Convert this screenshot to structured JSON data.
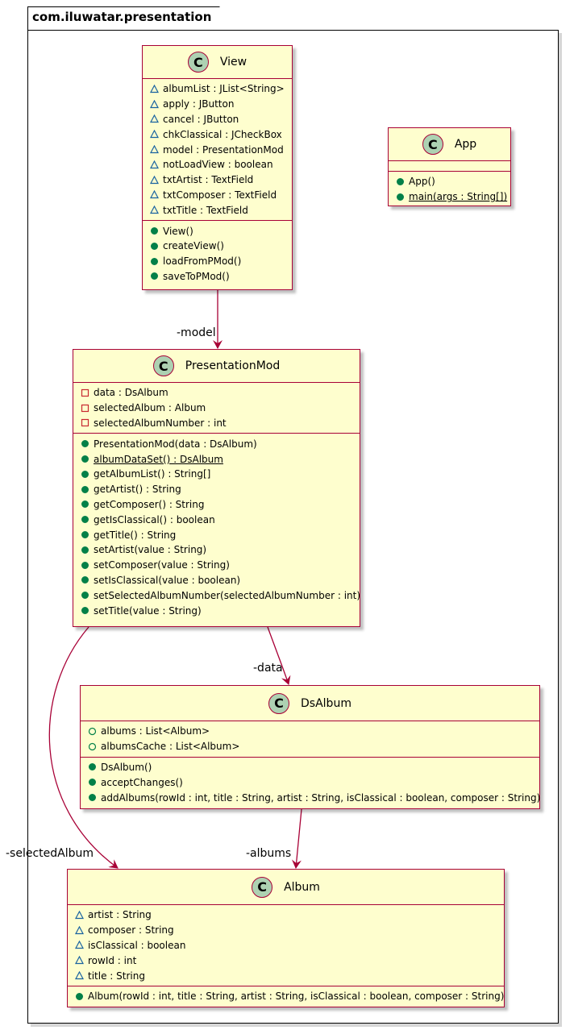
{
  "package": {
    "name": "com.iluwatar.presentation"
  },
  "classes": {
    "view": {
      "badge": "C",
      "name": "View",
      "fields": [
        {
          "vis": "package",
          "text": "albumList : JList<String>"
        },
        {
          "vis": "package",
          "text": "apply : JButton"
        },
        {
          "vis": "package",
          "text": "cancel : JButton"
        },
        {
          "vis": "package",
          "text": "chkClassical : JCheckBox"
        },
        {
          "vis": "package",
          "text": "model : PresentationMod"
        },
        {
          "vis": "package",
          "text": "notLoadView : boolean"
        },
        {
          "vis": "package",
          "text": "txtArtist : TextField"
        },
        {
          "vis": "package",
          "text": "txtComposer : TextField"
        },
        {
          "vis": "package",
          "text": "txtTitle : TextField"
        }
      ],
      "methods": [
        {
          "vis": "public",
          "text": "View()"
        },
        {
          "vis": "public",
          "text": "createView()"
        },
        {
          "vis": "public",
          "text": "loadFromPMod()"
        },
        {
          "vis": "public",
          "text": "saveToPMod()"
        }
      ]
    },
    "app": {
      "badge": "C",
      "name": "App",
      "fields": [],
      "methods": [
        {
          "vis": "public",
          "text": "App()"
        },
        {
          "vis": "public",
          "text": "main(args : String[])",
          "static": true
        }
      ]
    },
    "presentation_mod": {
      "badge": "C",
      "name": "PresentationMod",
      "fields": [
        {
          "vis": "private",
          "text": "data : DsAlbum"
        },
        {
          "vis": "private",
          "text": "selectedAlbum : Album"
        },
        {
          "vis": "private",
          "text": "selectedAlbumNumber : int"
        }
      ],
      "methods": [
        {
          "vis": "public",
          "text": "PresentationMod(data : DsAlbum)"
        },
        {
          "vis": "public",
          "text": "albumDataSet() : DsAlbum",
          "static": true
        },
        {
          "vis": "public",
          "text": "getAlbumList() : String[]"
        },
        {
          "vis": "public",
          "text": "getArtist() : String"
        },
        {
          "vis": "public",
          "text": "getComposer() : String"
        },
        {
          "vis": "public",
          "text": "getIsClassical() : boolean"
        },
        {
          "vis": "public",
          "text": "getTitle() : String"
        },
        {
          "vis": "public",
          "text": "setArtist(value : String)"
        },
        {
          "vis": "public",
          "text": "setComposer(value : String)"
        },
        {
          "vis": "public",
          "text": "setIsClassical(value : boolean)"
        },
        {
          "vis": "public",
          "text": "setSelectedAlbumNumber(selectedAlbumNumber : int)"
        },
        {
          "vis": "public",
          "text": "setTitle(value : String)"
        }
      ]
    },
    "ds_album": {
      "badge": "C",
      "name": "DsAlbum",
      "fields": [
        {
          "vis": "public-field",
          "text": "albums : List<Album>"
        },
        {
          "vis": "public-field",
          "text": "albumsCache : List<Album>"
        }
      ],
      "methods": [
        {
          "vis": "public",
          "text": "DsAlbum()"
        },
        {
          "vis": "public",
          "text": "acceptChanges()"
        },
        {
          "vis": "public",
          "text": "addAlbums(rowId : int, title : String, artist : String, isClassical : boolean, composer : String)"
        }
      ]
    },
    "album": {
      "badge": "C",
      "name": "Album",
      "fields": [
        {
          "vis": "package",
          "text": "artist : String"
        },
        {
          "vis": "package",
          "text": "composer : String"
        },
        {
          "vis": "package",
          "text": "isClassical : boolean"
        },
        {
          "vis": "package",
          "text": "rowId : int"
        },
        {
          "vis": "package",
          "text": "title : String"
        }
      ],
      "methods": [
        {
          "vis": "public",
          "text": "Album(rowId : int, title : String, artist : String, isClassical : boolean, composer : String)"
        }
      ]
    }
  },
  "relations": [
    {
      "from": "View",
      "to": "PresentationMod",
      "label": "-model"
    },
    {
      "from": "PresentationMod",
      "to": "DsAlbum",
      "label": "-data"
    },
    {
      "from": "PresentationMod",
      "to": "Album",
      "label": "-selectedAlbum"
    },
    {
      "from": "DsAlbum",
      "to": "Album",
      "label": "-albums"
    }
  ],
  "colors": {
    "class_fill": "#fefece",
    "class_border": "#a80036",
    "badge_fill": "#add1b2",
    "arrow": "#a80036",
    "public": "#038048",
    "private": "#c82930",
    "package": "#1963a0"
  }
}
